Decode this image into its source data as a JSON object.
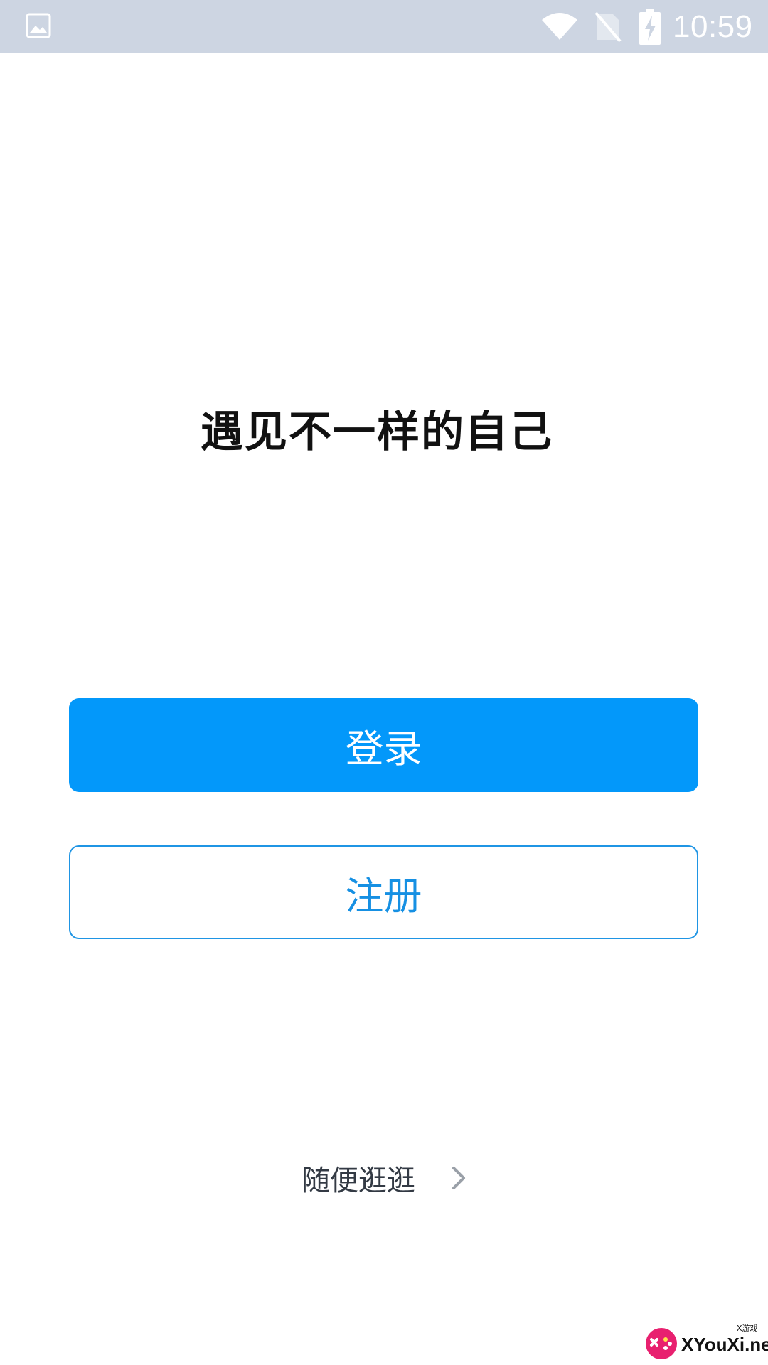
{
  "status_bar": {
    "time": "10:59",
    "icons": [
      "gallery-icon",
      "wifi-icon",
      "no-sim-icon",
      "battery-charging-icon"
    ],
    "background_color": "#cdd5e2"
  },
  "main": {
    "slogan": "遇见不一样的自己"
  },
  "actions": {
    "login_label": "登录",
    "register_label": "注册",
    "browse_label": "随便逛逛",
    "primary_color": "#0398fa"
  },
  "watermark": {
    "text": "XYouXi.net",
    "small_text": "X游戏"
  }
}
